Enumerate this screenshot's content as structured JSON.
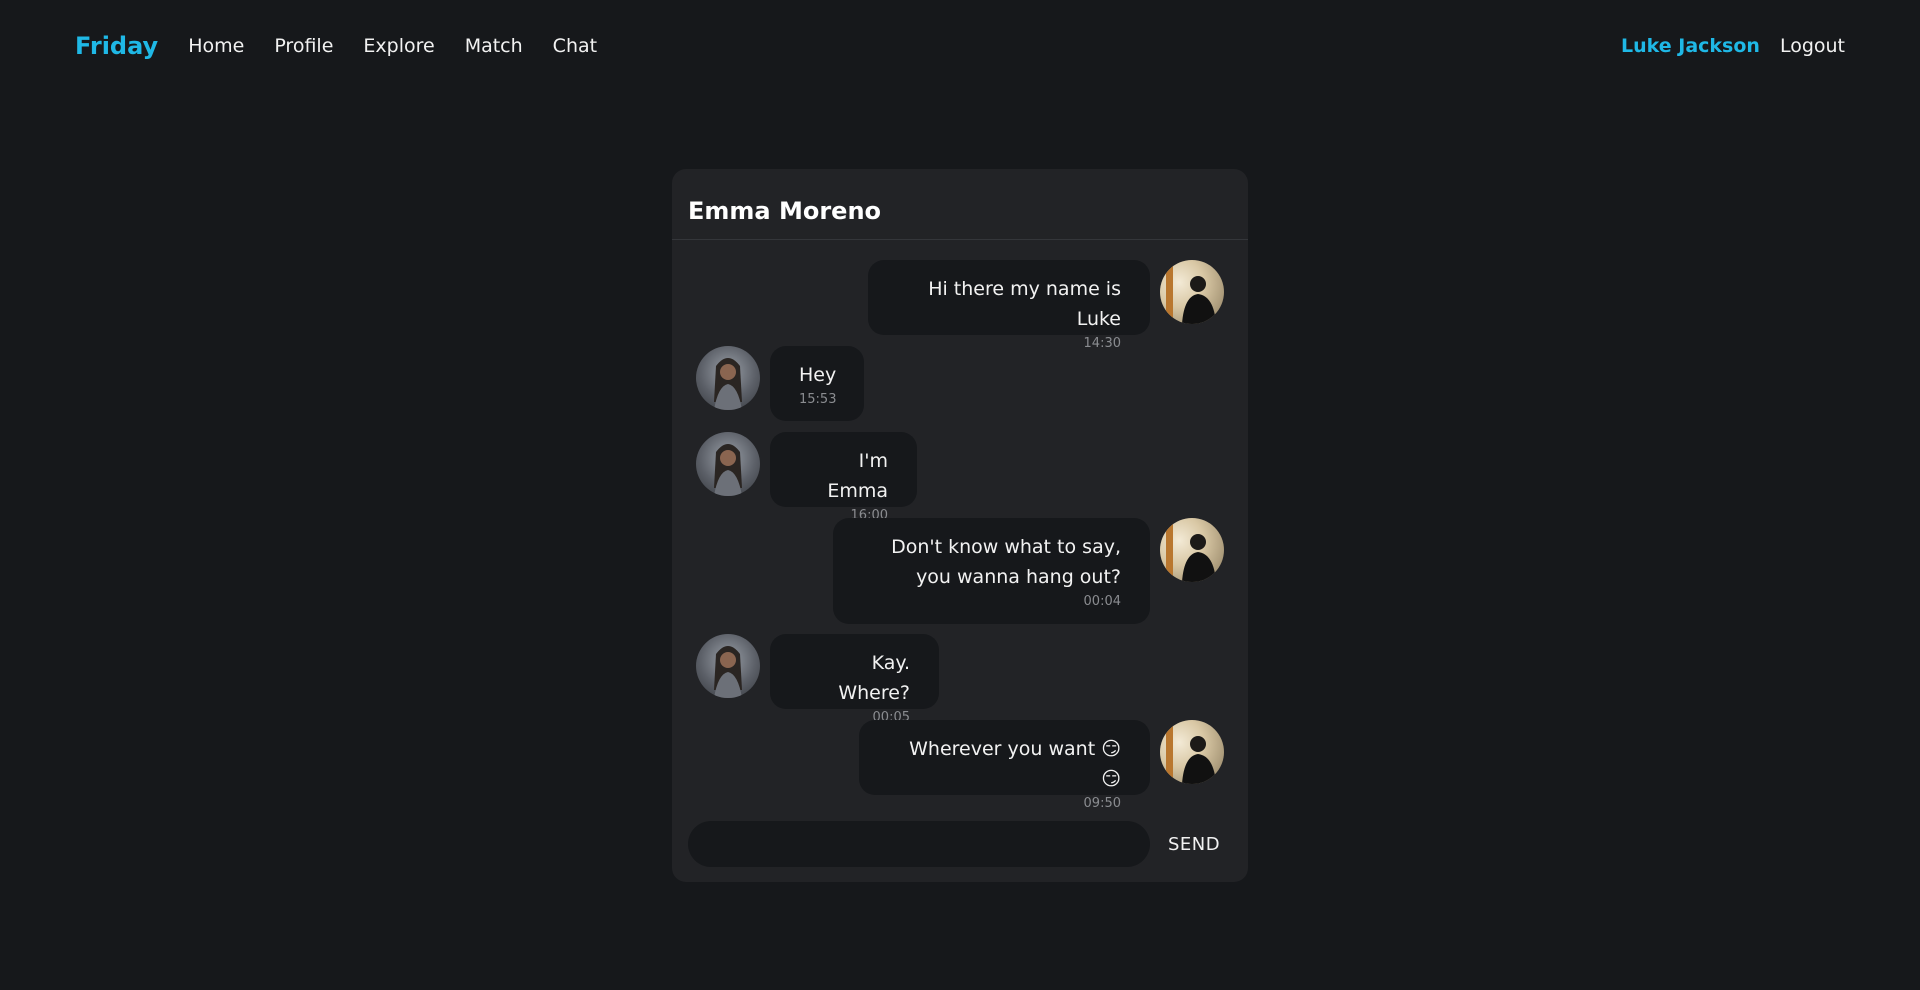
{
  "nav": {
    "brand": "Friday",
    "links": [
      "Home",
      "Profile",
      "Explore",
      "Match",
      "Chat"
    ],
    "user": "Luke Jackson",
    "logout": "Logout"
  },
  "chat": {
    "partner_name": "Emma Moreno",
    "messages": [
      {
        "from": "Luke Jackson",
        "text": "Hi there my name is Luke",
        "time": "14:30"
      },
      {
        "from": "Emma Moreno",
        "text": "Hey",
        "time": "15:53"
      },
      {
        "from": "Emma Moreno",
        "text": "I'm Emma",
        "time": "16:00"
      },
      {
        "from": "Luke Jackson",
        "text": "Don't know what to say, you wanna hang out?",
        "time": "00:04"
      },
      {
        "from": "Emma Moreno",
        "text": "Kay. Where?",
        "time": "00:05"
      },
      {
        "from": "Luke Jackson",
        "text": "Wherever you want 😏 😏",
        "time": "09:50"
      }
    ],
    "input_value": "",
    "input_placeholder": "",
    "send_label": "SEND"
  },
  "colors": {
    "background": "#16181b",
    "card": "#222326",
    "accent": "#1fb8e6",
    "bubble": "#16181b"
  }
}
